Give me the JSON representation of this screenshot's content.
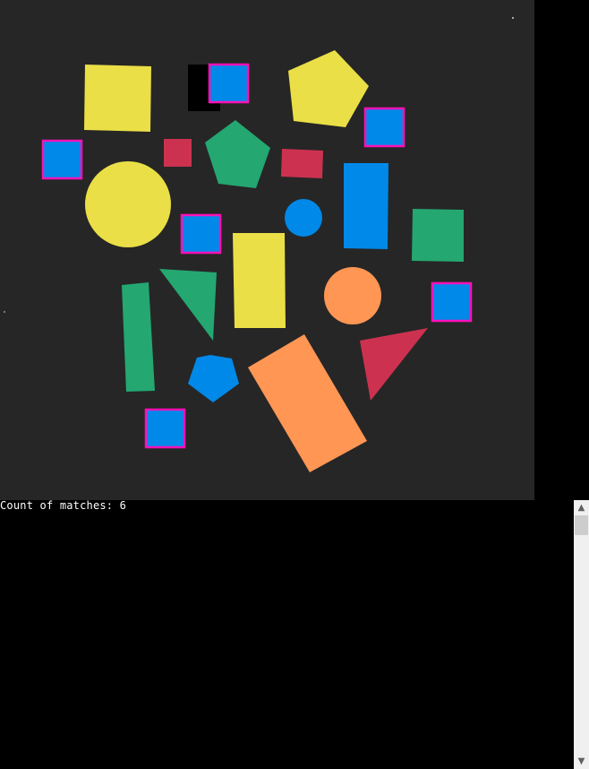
{
  "console": {
    "output_line": "Count of matches: 6"
  },
  "image": {
    "background_color": "#262626",
    "shape_colors": {
      "yellow": "#eadf46",
      "green": "#24a771",
      "red": "#cc3250",
      "blue": "#0089e8",
      "orange": "#ff9654"
    },
    "match_highlight_color": "#ff10b8",
    "match_count": 6
  },
  "scrollbar": {
    "up_icon": "▲",
    "down_icon": "▼"
  }
}
